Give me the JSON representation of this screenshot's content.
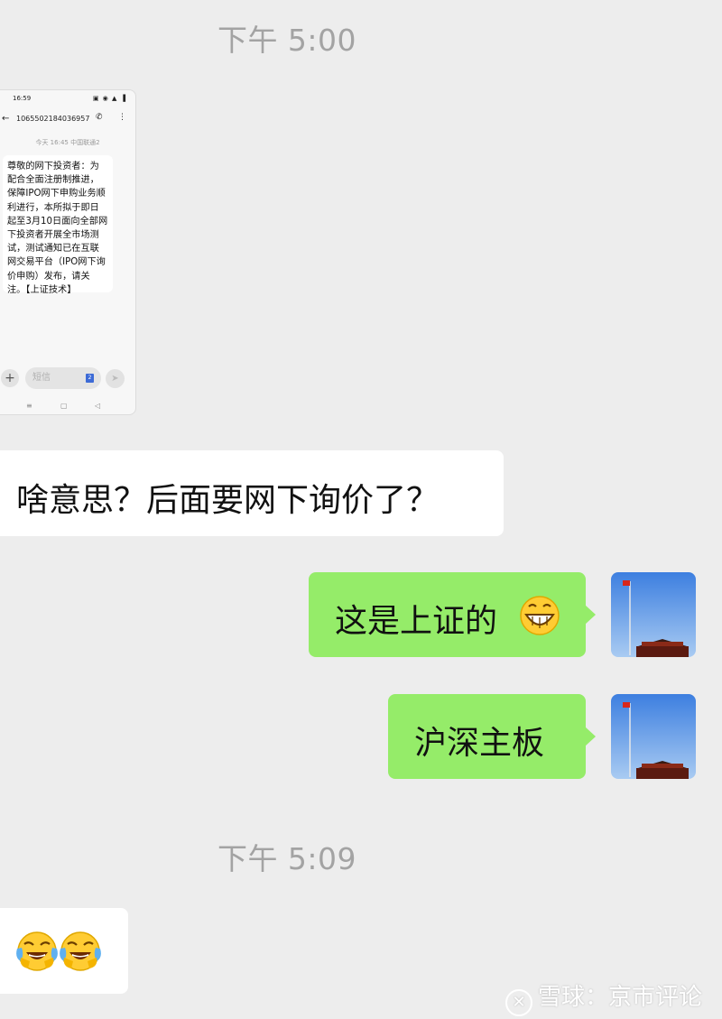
{
  "timestamps": [
    "下午 5:00",
    "下午 5:09"
  ],
  "screenshot": {
    "status_time": "16:59",
    "sender_number": "1065502184036957",
    "date_line": "今天 16:45 中国联通2",
    "message": "尊敬的网下投资者：为配合全面注册制推进，保障IPO网下申购业务顺利进行，本所拟于即日起至3月10日面向全部网下投资者开展全市场测试，测试通知已在互联网交易平台（IPO网下询价申购）发布，请关注。【上证技术】",
    "input_placeholder": "短信",
    "sim_badge": "2"
  },
  "messages": {
    "left_1": "啥意思？后面要网下询价了？",
    "right_1": "这是上证的",
    "right_2": "沪深主板"
  },
  "icons": {
    "right_1_emoji": "grinning-face-emoji",
    "left_2_emojis": [
      "crying-laughing-emoji",
      "crying-laughing-emoji"
    ]
  },
  "watermark": {
    "logo_glyph": "✕",
    "text": "雪球：京市评论"
  },
  "colors": {
    "background": "#ededed",
    "bubble_sent": "#95ec69",
    "bubble_received": "#ffffff",
    "timestamp": "#a3a3a3"
  }
}
